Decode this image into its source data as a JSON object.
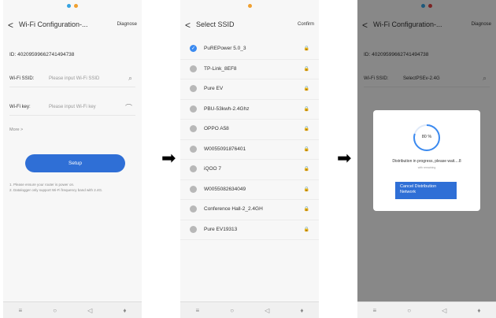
{
  "screen1": {
    "title": "Wi-Fi Configuration-...",
    "header_button": "Diagnose",
    "device_id": "ID: 40209599662741494738",
    "ssid_label": "Wi-Fi SSID:",
    "ssid_placeholder": "Please input Wi-Fi SSID",
    "key_label": "Wi-Fi key:",
    "key_placeholder": "Please input Wi-Fi key",
    "more": "More >",
    "setup_button": "Setup",
    "note1": "1. Please ensure your router is power on.",
    "note2": "2. Datalogger only support Wi-Fi frequency band with 2.4G."
  },
  "screen2": {
    "title": "Select SSID",
    "confirm": "Confirm",
    "ssids": [
      {
        "name": "PuREPower 5.0_3",
        "selected": true
      },
      {
        "name": "TP-Link_8EF8",
        "selected": false
      },
      {
        "name": "Pure EV",
        "selected": false
      },
      {
        "name": "PBU-53kwh-2.4Ghz",
        "selected": false
      },
      {
        "name": "OPPO A58",
        "selected": false
      },
      {
        "name": "W0055091876401",
        "selected": false
      },
      {
        "name": "iQOO 7",
        "selected": false
      },
      {
        "name": "W0055082634049",
        "selected": false
      },
      {
        "name": "Conference Hall-2_2.4GH",
        "selected": false
      },
      {
        "name": "Pure EV19313",
        "selected": false
      }
    ]
  },
  "screen3": {
    "title": "Wi-Fi Configuration-...",
    "header_button": "Diagnose",
    "device_id": "ID: 40209599662741494738",
    "ssid_label": "Wi-Fi SSID:",
    "ssid_value": "SelectPSEv-2.4G",
    "progress_text": "80 %",
    "progress": 0.8,
    "message": "Distribution in progress, please wait....8",
    "submessage": "with remaining",
    "cancel_button": "Cancel Distribution Network"
  },
  "colors": {
    "accent": "#2f6fd6",
    "selected": "#3b8af0"
  }
}
